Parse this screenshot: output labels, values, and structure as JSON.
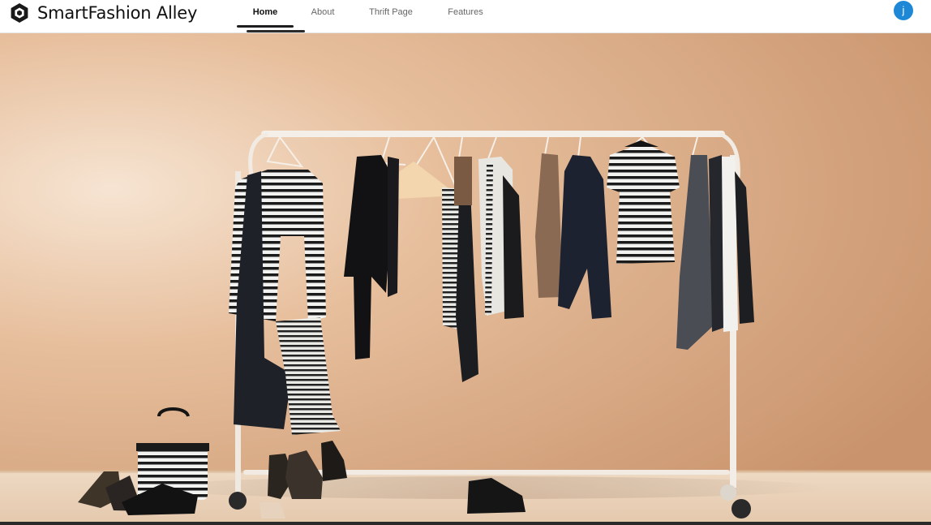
{
  "header": {
    "brand_name": "SmartFashion Alley",
    "nav_tabs": [
      {
        "label": "Home",
        "active": true
      },
      {
        "label": "About",
        "active": false
      },
      {
        "label": "Thrift Page",
        "active": false
      },
      {
        "label": "Features",
        "active": false
      }
    ],
    "user_avatar_initial": "j"
  },
  "colors": {
    "accent": "#1e88d6",
    "wall": "#d8a784",
    "floor": "#ecd6bf"
  },
  "icons": {
    "brand": "hexagon-logo-icon"
  }
}
